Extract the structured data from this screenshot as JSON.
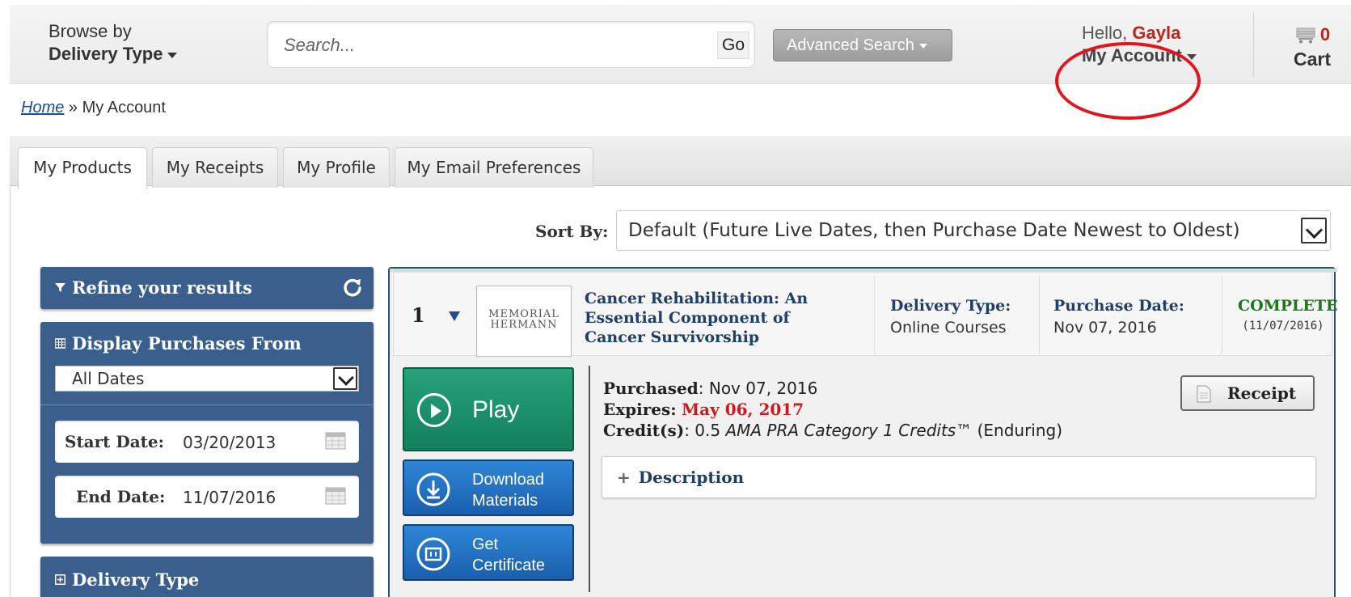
{
  "header": {
    "browse_line1": "Browse by",
    "browse_line2": "Delivery Type",
    "search_placeholder": "Search...",
    "go_label": "Go",
    "advanced_search_label": "Advanced Search",
    "hello_prefix": "Hello,",
    "user_name": "Gayla",
    "my_account_label": "My Account",
    "cart_count": "0",
    "cart_label": "Cart"
  },
  "breadcrumb": {
    "home": "Home",
    "separator": "»",
    "current": "My Account"
  },
  "tabs": [
    {
      "label": "My Products",
      "active": true
    },
    {
      "label": "My Receipts",
      "active": false
    },
    {
      "label": "My Profile",
      "active": false
    },
    {
      "label": "My Email Preferences",
      "active": false
    }
  ],
  "sort": {
    "label": "Sort By:",
    "selected": "Default (Future Live Dates, then Purchase Date Newest to Oldest)"
  },
  "sidebar": {
    "refine_title": "Refine your results",
    "display_title": "Display Purchases From",
    "dates_selected": "All Dates",
    "start_label": "Start Date:",
    "start_value": "03/20/2013",
    "end_label": "End Date:",
    "end_value": "11/07/2016",
    "delivery_title": "Delivery Type"
  },
  "product": {
    "number": "1",
    "logo_line1": "MEMORIAL",
    "logo_line2": "HERMANN",
    "title": "Cancer Rehabilitation: An Essential Component of Cancer Survivorship",
    "delivery_label": "Delivery Type:",
    "delivery_value": "Online Courses",
    "purchase_label": "Purchase Date:",
    "purchase_value": "Nov 07, 2016",
    "status": "COMPLETE",
    "status_date": "(11/07/2016)",
    "play_label": "Play",
    "download_line1": "Download",
    "download_line2": "Materials",
    "cert_line1": "Get",
    "cert_line2": "Certificate",
    "purchased_label": "Purchased",
    "purchased_value": ": Nov 07, 2016",
    "expires_label": "Expires:",
    "expires_value": "May 06, 2017",
    "credits_label": "Credit(s)",
    "credits_prefix": ": 0.5 ",
    "credits_italic": "AMA PRA Category 1 Credits",
    "credits_suffix": "™ (Enduring)",
    "receipt_label": "Receipt",
    "description_label": "Description"
  },
  "colors": {
    "accent_red": "#c0241c",
    "panel_blue": "#3b5f8c",
    "play_green": "#12805c",
    "button_blue": "#1a5fae",
    "status_green": "#1a7a1a",
    "annotation_red": "#e3141c"
  }
}
